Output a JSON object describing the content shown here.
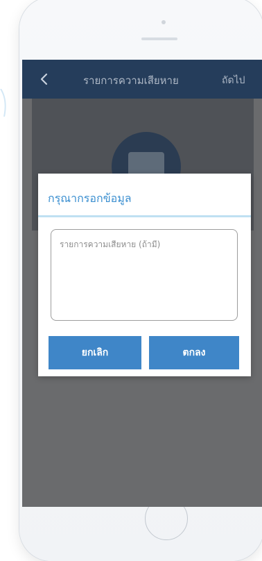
{
  "appbar": {
    "title": "รายการความเสียหาย",
    "next_label": "ถัดไป"
  },
  "dialog": {
    "title": "กรุณากรอกข้อมูล",
    "textarea_value": "",
    "textarea_placeholder": "รายการความเสียหาย (ถ้ามี)",
    "cancel_label": "ยกเลิก",
    "ok_label": "ตกลง"
  },
  "icons": {
    "back": "chevron-left-icon",
    "avatar": "document-icon"
  },
  "colors": {
    "appbar": "#253d5b",
    "accent": "#3f86c8",
    "title": "#3b8fd0",
    "overlay": "#6a6b6d"
  }
}
